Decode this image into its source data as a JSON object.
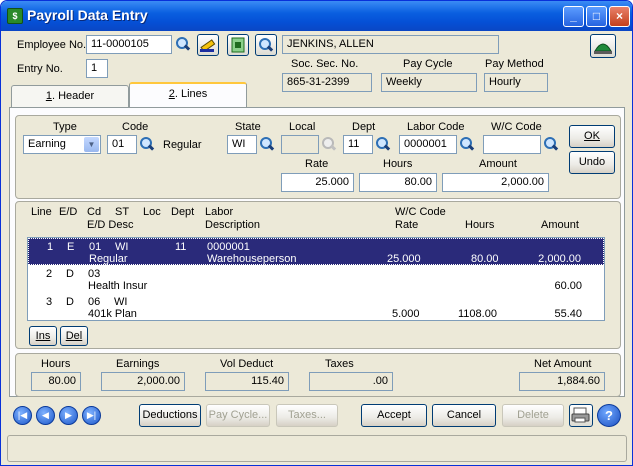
{
  "window": {
    "title": "Payroll Data Entry",
    "title_icon": "payroll-app-icon"
  },
  "header": {
    "employee_no_label": "Employee No.",
    "employee_no_value": "11-0000105",
    "employee_name": "JENKINS, ALLEN",
    "entry_no_label": "Entry No.",
    "entry_no_value": "1",
    "ssn_label": "Soc. Sec. No.",
    "ssn_value": "865-31-2399",
    "pay_cycle_label": "Pay Cycle",
    "pay_cycle_value": "Weekly",
    "pay_method_label": "Pay Method",
    "pay_method_value": "Hourly"
  },
  "tabs": [
    {
      "key": "1",
      "label": ". Header"
    },
    {
      "key": "2",
      "label": ". Lines"
    }
  ],
  "line_entry": {
    "type_label": "Type",
    "type_value": "Earning",
    "code_label": "Code",
    "code_value": "01",
    "code_desc": "Regular",
    "state_label": "State",
    "state_value": "WI",
    "local_label": "Local",
    "local_value": "",
    "dept_label": "Dept",
    "dept_value": "11",
    "labor_code_label": "Labor Code",
    "labor_code_value": "0000001",
    "wc_code_label": "W/C Code",
    "wc_code_value": "",
    "rate_label": "Rate",
    "rate_value": "25.000",
    "hours_label": "Hours",
    "hours_value": "80.00",
    "amount_label": "Amount",
    "amount_value": "2,000.00",
    "ok_label": "OK",
    "undo_label": "Undo"
  },
  "grid": {
    "headers_row1": {
      "line": "Line",
      "ed": "E/D",
      "cd": "Cd",
      "st": "ST",
      "loc": "Loc",
      "dept": "Dept",
      "labor": "Labor",
      "wc": "W/C Code"
    },
    "headers_row2": {
      "eddesc": "E/D Desc",
      "desc": "Description",
      "rate": "Rate",
      "hours": "Hours",
      "amount": "Amount"
    },
    "rows": [
      {
        "line": "1",
        "ed": "E",
        "cd": "01",
        "st": "WI",
        "loc": "",
        "dept": "11",
        "labor": "0000001",
        "desc": "Regular",
        "labor_desc": "Warehouseperson",
        "rate": "25.000",
        "hours": "80.00",
        "amount": "2,000.00",
        "selected": true
      },
      {
        "line": "2",
        "ed": "D",
        "cd": "03",
        "st": "",
        "loc": "",
        "dept": "",
        "labor": "",
        "desc": "Health Insur",
        "labor_desc": "",
        "rate": "",
        "hours": "",
        "amount": "60.00",
        "selected": false
      },
      {
        "line": "3",
        "ed": "D",
        "cd": "06",
        "st": "WI",
        "loc": "",
        "dept": "",
        "labor": "",
        "desc": "401k Plan",
        "labor_desc": "",
        "rate": "5.000",
        "hours": "1108.00",
        "amount": "55.40",
        "selected": false
      }
    ],
    "ins_label": "Ins",
    "del_label": "Del"
  },
  "totals": {
    "hours_label": "Hours",
    "hours_value": "80.00",
    "earnings_label": "Earnings",
    "earnings_value": "2,000.00",
    "vol_deduct_label": "Vol Deduct",
    "vol_deduct_value": "115.40",
    "taxes_label": "Taxes",
    "taxes_value": ".00",
    "net_amount_label": "Net Amount",
    "net_amount_value": "1,884.60"
  },
  "footer": {
    "deductions_label": "Deductions",
    "pay_cycle_label": "Pay Cycle...",
    "taxes_label": "Taxes...",
    "accept_label": "Accept",
    "cancel_label": "Cancel",
    "delete_label": "Delete"
  },
  "colors": {
    "title_bar": "#0a5fe0",
    "selected_row": "#2a2a7a",
    "accent": "#ffc73c"
  }
}
